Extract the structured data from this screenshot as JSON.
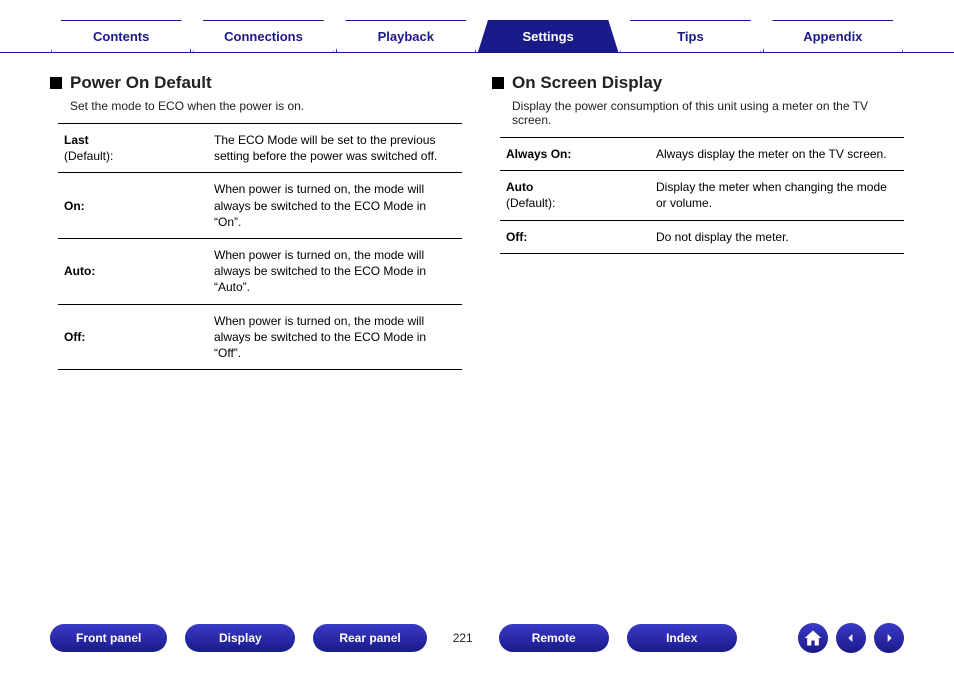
{
  "tabs": [
    {
      "label": "Contents",
      "active": false
    },
    {
      "label": "Connections",
      "active": false
    },
    {
      "label": "Playback",
      "active": false
    },
    {
      "label": "Settings",
      "active": true
    },
    {
      "label": "Tips",
      "active": false
    },
    {
      "label": "Appendix",
      "active": false
    }
  ],
  "left": {
    "title": "Power On Default",
    "desc": "Set the mode to ECO when the power is on.",
    "rows": [
      {
        "name": "Last",
        "sub": "(Default):",
        "desc": "The ECO Mode will be set to the previous setting before the power was switched off."
      },
      {
        "name": "On:",
        "sub": "",
        "desc": "When power is turned on, the mode will always be switched to the ECO Mode in “On”."
      },
      {
        "name": "Auto:",
        "sub": "",
        "desc": "When power is turned on, the mode will always be switched to the ECO Mode in “Auto”."
      },
      {
        "name": "Off:",
        "sub": "",
        "desc": "When power is turned on, the mode will always be switched to the ECO Mode in “Off”."
      }
    ]
  },
  "right": {
    "title": "On Screen Display",
    "desc": "Display the power consumption of this unit using a meter on the TV screen.",
    "rows": [
      {
        "name": "Always On:",
        "sub": "",
        "desc": "Always display the meter on the TV screen."
      },
      {
        "name": "Auto",
        "sub": "(Default):",
        "desc": "Display the meter when changing the mode or volume."
      },
      {
        "name": "Off:",
        "sub": "",
        "desc": "Do not display the meter."
      }
    ]
  },
  "bottom": {
    "front_panel": "Front panel",
    "display": "Display",
    "rear_panel": "Rear panel",
    "page": "221",
    "remote": "Remote",
    "index": "Index"
  }
}
